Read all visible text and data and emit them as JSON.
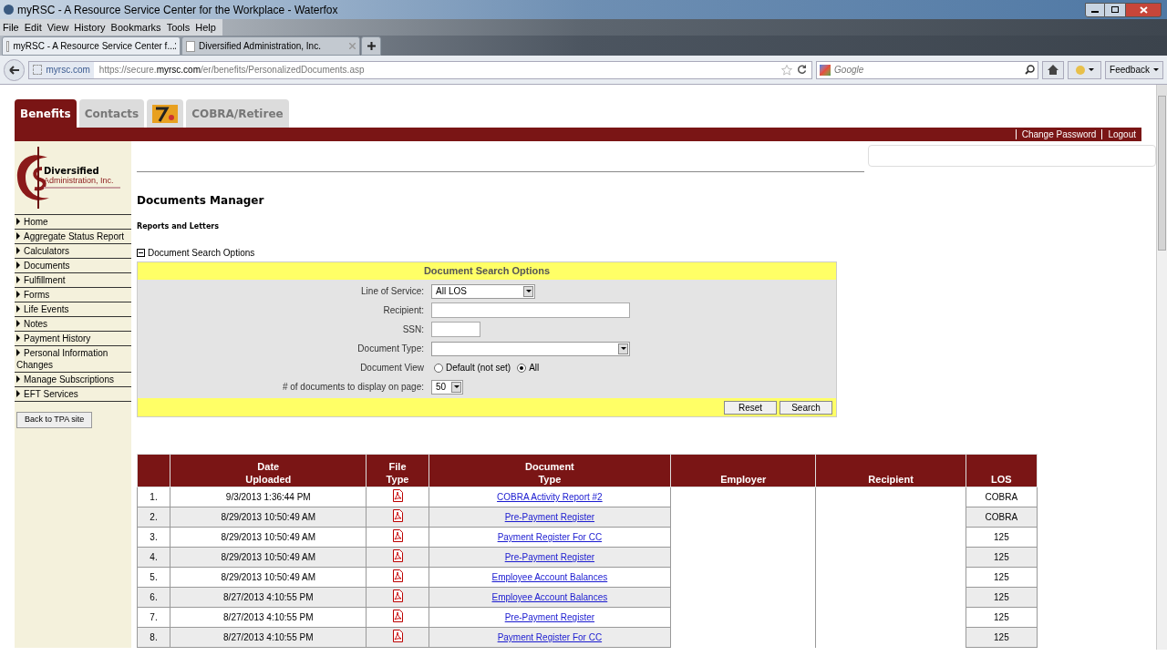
{
  "window": {
    "title": "myRSC - A Resource Service Center for the Workplace - Waterfox"
  },
  "menu": [
    "File",
    "Edit",
    "View",
    "History",
    "Bookmarks",
    "Tools",
    "Help"
  ],
  "browser_tabs": [
    {
      "label": "myRSC - A Resource Service Center f...",
      "selected": true
    },
    {
      "label": "Diversified Administration, Inc.",
      "selected": false
    }
  ],
  "address_bar": {
    "site": "myrsc.com",
    "url_prefix": "https://secure.",
    "url_domain": "myrsc.com",
    "url_path": "/er/benefits/PersonalizedDocuments.asp"
  },
  "search_field": {
    "placeholder": "Google"
  },
  "feedback_button": "Feedback",
  "site_tabs": [
    {
      "kind": "text",
      "label": "Benefits",
      "selected": true
    },
    {
      "kind": "text",
      "label": "Contacts",
      "selected": false
    },
    {
      "kind": "image",
      "selected": false
    },
    {
      "kind": "text",
      "label": "COBRA/Retiree",
      "selected": false
    }
  ],
  "header_links": [
    "Change Password",
    "Logout"
  ],
  "logo": {
    "name": "Diversified",
    "sub": "Administration, Inc."
  },
  "sidebar": {
    "items": [
      "Home",
      "Aggregate Status Report",
      "Calculators",
      "Documents",
      "Fulfillment",
      "Forms",
      "Life Events",
      "Notes",
      "Payment History",
      "Personal Information Changes",
      "Manage Subscriptions",
      "EFT Services"
    ],
    "back_button": "Back to TPA site"
  },
  "page_title": "Documents Manager",
  "subtitle": "Reports and Letters",
  "search_options": {
    "toggle_label": "Document Search Options",
    "expanded": true,
    "panel_title": "Document Search Options",
    "fields": [
      {
        "kind": "select",
        "label": "Line of Service:",
        "value": "All LOS"
      },
      {
        "kind": "text",
        "label": "Recipient:"
      },
      {
        "kind": "text",
        "label": "SSN:"
      },
      {
        "kind": "select",
        "label": "Document Type:"
      },
      {
        "kind": "radio",
        "label": "Document View",
        "options": [
          {
            "label": "Default (not set)",
            "selected": false
          },
          {
            "label": "All",
            "selected": true
          }
        ]
      },
      {
        "kind": "select",
        "label": "# of documents to display on page:",
        "value": "50"
      }
    ],
    "buttons": [
      "Reset",
      "Search"
    ]
  },
  "table": {
    "columns": [
      "",
      "Date Uploaded",
      "File Type",
      "Document Type",
      "Employer",
      "Recipient",
      "LOS"
    ],
    "rows": [
      {
        "number": "1.",
        "date": "9/3/2013 1:36:44 PM",
        "document": "COBRA Activity Report #2",
        "los": "COBRA"
      },
      {
        "number": "2.",
        "date": "8/29/2013 10:50:49 AM",
        "document": "Pre-Payment Register",
        "los": "COBRA"
      },
      {
        "number": "3.",
        "date": "8/29/2013 10:50:49 AM",
        "document": "Payment Register For CC",
        "los": "125"
      },
      {
        "number": "4.",
        "date": "8/29/2013 10:50:49 AM",
        "document": "Pre-Payment Register",
        "los": "125"
      },
      {
        "number": "5.",
        "date": "8/29/2013 10:50:49 AM",
        "document": "Employee Account Balances",
        "los": "125"
      },
      {
        "number": "6.",
        "date": "8/27/2013 4:10:55 PM",
        "document": "Employee Account Balances",
        "los": "125"
      },
      {
        "number": "7.",
        "date": "8/27/2013 4:10:55 PM",
        "document": "Pre-Payment Register",
        "los": "125"
      },
      {
        "number": "8.",
        "date": "8/27/2013 4:10:55 PM",
        "document": "Payment Register For CC",
        "los": "125"
      }
    ]
  }
}
